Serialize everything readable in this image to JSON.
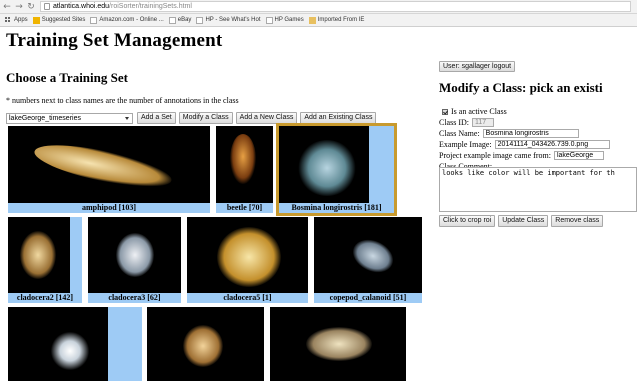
{
  "browser": {
    "url_host": "atlantica.whoi.edu",
    "url_path": "/roiSorter/trainingSets.html",
    "bookmarks": [
      "Apps",
      "Suggested Sites",
      "Amazon.com - Online ...",
      "eBay",
      "HP - See What's Hot",
      "HP Games",
      "Imported From IE"
    ]
  },
  "page": {
    "title": "Training Set Management",
    "choose_heading": "Choose a Training Set",
    "note": "* numbers next to class names are the number of annotations in the class"
  },
  "controls": {
    "selected_set": "lakeGeorge_timeseries",
    "add_set": "Add a Set",
    "modify_class": "Modify a Class",
    "add_new_class": "Add a New Class",
    "add_existing_class": "Add an Existing Class"
  },
  "thumbnails": [
    {
      "label": "amphipod [103]"
    },
    {
      "label": "beetle [70]"
    },
    {
      "label": "Bosmina longirostris [181]",
      "selected": true
    },
    {
      "label": "cladocera2 [142]"
    },
    {
      "label": "cladocera3 [62]"
    },
    {
      "label": "cladocera5 [1]"
    },
    {
      "label": "copepod_calanoid [51]"
    },
    {
      "label": ""
    },
    {
      "label": ""
    },
    {
      "label": ""
    }
  ],
  "panel": {
    "user_button": "User: sgallager logout",
    "heading": "Modify a Class:  pick an existi",
    "active_label": "Is an active Class",
    "class_id_label": "Class ID:",
    "class_id_value": "117",
    "class_name_label": "Class Name:",
    "class_name_value": "Bosmina longirostris",
    "example_image_label": "Example Image:",
    "example_image_value": "20141114_043426.739.0.png",
    "project_image_label": "Project example image came from:",
    "project_image_value": "lakeGeorge",
    "comment_label": "Class Comment:",
    "comment_value": "looks like color will be important for th",
    "crop_button": "Click to crop roi",
    "update_button": "Update Class",
    "remove_button": "Remove class"
  },
  "colors": {
    "caption_bg": "#9ecbf5",
    "selected_border": "#c89a2e"
  }
}
